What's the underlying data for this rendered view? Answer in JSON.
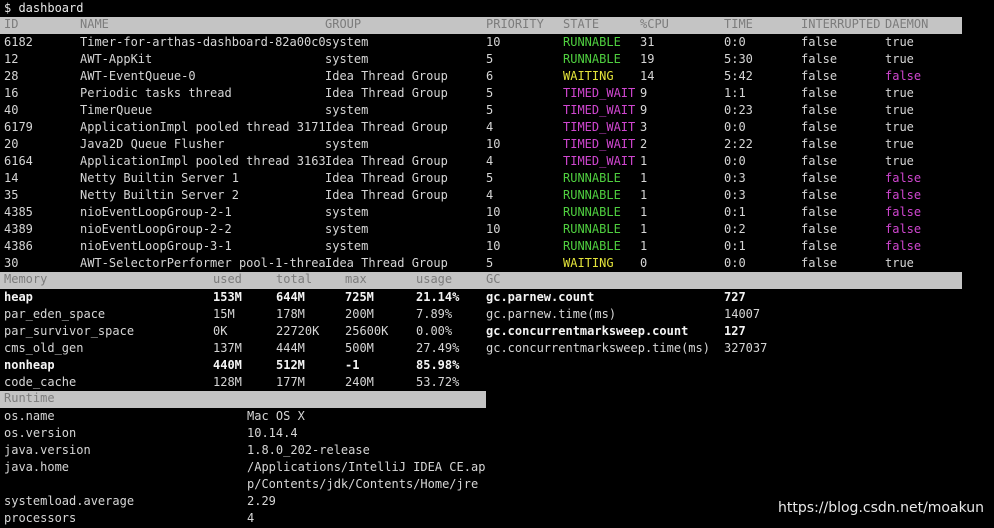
{
  "prompt": "$ dashboard",
  "thread_headers": [
    "ID",
    "NAME",
    "GROUP",
    "PRIORITY",
    "STATE",
    "%CPU",
    "TIME",
    "INTERRUPTED",
    "DAEMON"
  ],
  "threads": [
    {
      "id": "6182",
      "name": "Timer-for-arthas-dashboard-82a00c0",
      "group": "system",
      "priority": "10",
      "state": "RUNNABLE",
      "cpu": "31",
      "time": "0:0",
      "interrupted": "false",
      "daemon": "true"
    },
    {
      "id": "12",
      "name": "AWT-AppKit",
      "group": "system",
      "priority": "5",
      "state": "RUNNABLE",
      "cpu": "19",
      "time": "5:30",
      "interrupted": "false",
      "daemon": "true"
    },
    {
      "id": "28",
      "name": "AWT-EventQueue-0",
      "group": "Idea Thread Group",
      "priority": "6",
      "state": "WAITING",
      "cpu": "14",
      "time": "5:42",
      "interrupted": "false",
      "daemon": "false"
    },
    {
      "id": "16",
      "name": "Periodic tasks thread",
      "group": "Idea Thread Group",
      "priority": "5",
      "state": "TIMED_WAIT",
      "cpu": "9",
      "time": "1:1",
      "interrupted": "false",
      "daemon": "true"
    },
    {
      "id": "40",
      "name": "TimerQueue",
      "group": "system",
      "priority": "5",
      "state": "TIMED_WAIT",
      "cpu": "9",
      "time": "0:23",
      "interrupted": "false",
      "daemon": "true"
    },
    {
      "id": "6179",
      "name": "ApplicationImpl pooled thread 3171",
      "group": "Idea Thread Group",
      "priority": "4",
      "state": "TIMED_WAIT",
      "cpu": "3",
      "time": "0:0",
      "interrupted": "false",
      "daemon": "true"
    },
    {
      "id": "20",
      "name": "Java2D Queue Flusher",
      "group": "system",
      "priority": "10",
      "state": "TIMED_WAIT",
      "cpu": "2",
      "time": "2:22",
      "interrupted": "false",
      "daemon": "true"
    },
    {
      "id": "6164",
      "name": "ApplicationImpl pooled thread 3163",
      "group": "Idea Thread Group",
      "priority": "4",
      "state": "TIMED_WAIT",
      "cpu": "1",
      "time": "0:0",
      "interrupted": "false",
      "daemon": "true"
    },
    {
      "id": "14",
      "name": "Netty Builtin Server 1",
      "group": "Idea Thread Group",
      "priority": "5",
      "state": "RUNNABLE",
      "cpu": "1",
      "time": "0:3",
      "interrupted": "false",
      "daemon": "false"
    },
    {
      "id": "35",
      "name": "Netty Builtin Server 2",
      "group": "Idea Thread Group",
      "priority": "4",
      "state": "RUNNABLE",
      "cpu": "1",
      "time": "0:3",
      "interrupted": "false",
      "daemon": "false"
    },
    {
      "id": "4385",
      "name": "nioEventLoopGroup-2-1",
      "group": "system",
      "priority": "10",
      "state": "RUNNABLE",
      "cpu": "1",
      "time": "0:1",
      "interrupted": "false",
      "daemon": "false"
    },
    {
      "id": "4389",
      "name": "nioEventLoopGroup-2-2",
      "group": "system",
      "priority": "10",
      "state": "RUNNABLE",
      "cpu": "1",
      "time": "0:2",
      "interrupted": "false",
      "daemon": "false"
    },
    {
      "id": "4386",
      "name": "nioEventLoopGroup-3-1",
      "group": "system",
      "priority": "10",
      "state": "RUNNABLE",
      "cpu": "1",
      "time": "0:1",
      "interrupted": "false",
      "daemon": "false"
    },
    {
      "id": "30",
      "name": "AWT-SelectorPerformer pool-1-threa",
      "group": "Idea Thread Group",
      "priority": "5",
      "state": "WAITING",
      "cpu": "0",
      "time": "0:0",
      "interrupted": "false",
      "daemon": "true"
    }
  ],
  "memory_headers": [
    "Memory",
    "used",
    "total",
    "max",
    "usage"
  ],
  "gc_header": "GC",
  "memory": [
    {
      "name": "heap",
      "used": "153M",
      "total": "644M",
      "max": "725M",
      "usage": "21.14%",
      "bold": true
    },
    {
      "name": "par_eden_space",
      "used": "15M",
      "total": "178M",
      "max": "200M",
      "usage": "7.89%",
      "bold": false
    },
    {
      "name": "par_survivor_space",
      "used": "0K",
      "total": "22720K",
      "max": "25600K",
      "usage": "0.00%",
      "bold": false
    },
    {
      "name": "cms_old_gen",
      "used": "137M",
      "total": "444M",
      "max": "500M",
      "usage": "27.49%",
      "bold": false
    },
    {
      "name": "nonheap",
      "used": "440M",
      "total": "512M",
      "max": "-1",
      "usage": "85.98%",
      "bold": true
    },
    {
      "name": "code_cache",
      "used": "128M",
      "total": "177M",
      "max": "240M",
      "usage": "53.72%",
      "bold": false
    }
  ],
  "gc": [
    {
      "name": "gc.parnew.count",
      "value": "727",
      "bold": true
    },
    {
      "name": "gc.parnew.time(ms)",
      "value": "14007",
      "bold": false
    },
    {
      "name": "gc.concurrentmarksweep.count",
      "value": "127",
      "bold": true
    },
    {
      "name": "gc.concurrentmarksweep.time(ms)",
      "value": "327037",
      "bold": false
    }
  ],
  "runtime_header": "Runtime",
  "runtime": [
    {
      "name": "os.name",
      "value": "Mac OS X"
    },
    {
      "name": "os.version",
      "value": "10.14.4"
    },
    {
      "name": "java.version",
      "value": "1.8.0_202-release"
    },
    {
      "name": "java.home",
      "value": "/Applications/IntelliJ IDEA CE.ap"
    },
    {
      "name": "",
      "value": "p/Contents/jdk/Contents/Home/jre"
    },
    {
      "name": "systemload.average",
      "value": "2.29"
    },
    {
      "name": "processors",
      "value": "4"
    }
  ],
  "watermark": "https://blog.csdn.net/moakun"
}
